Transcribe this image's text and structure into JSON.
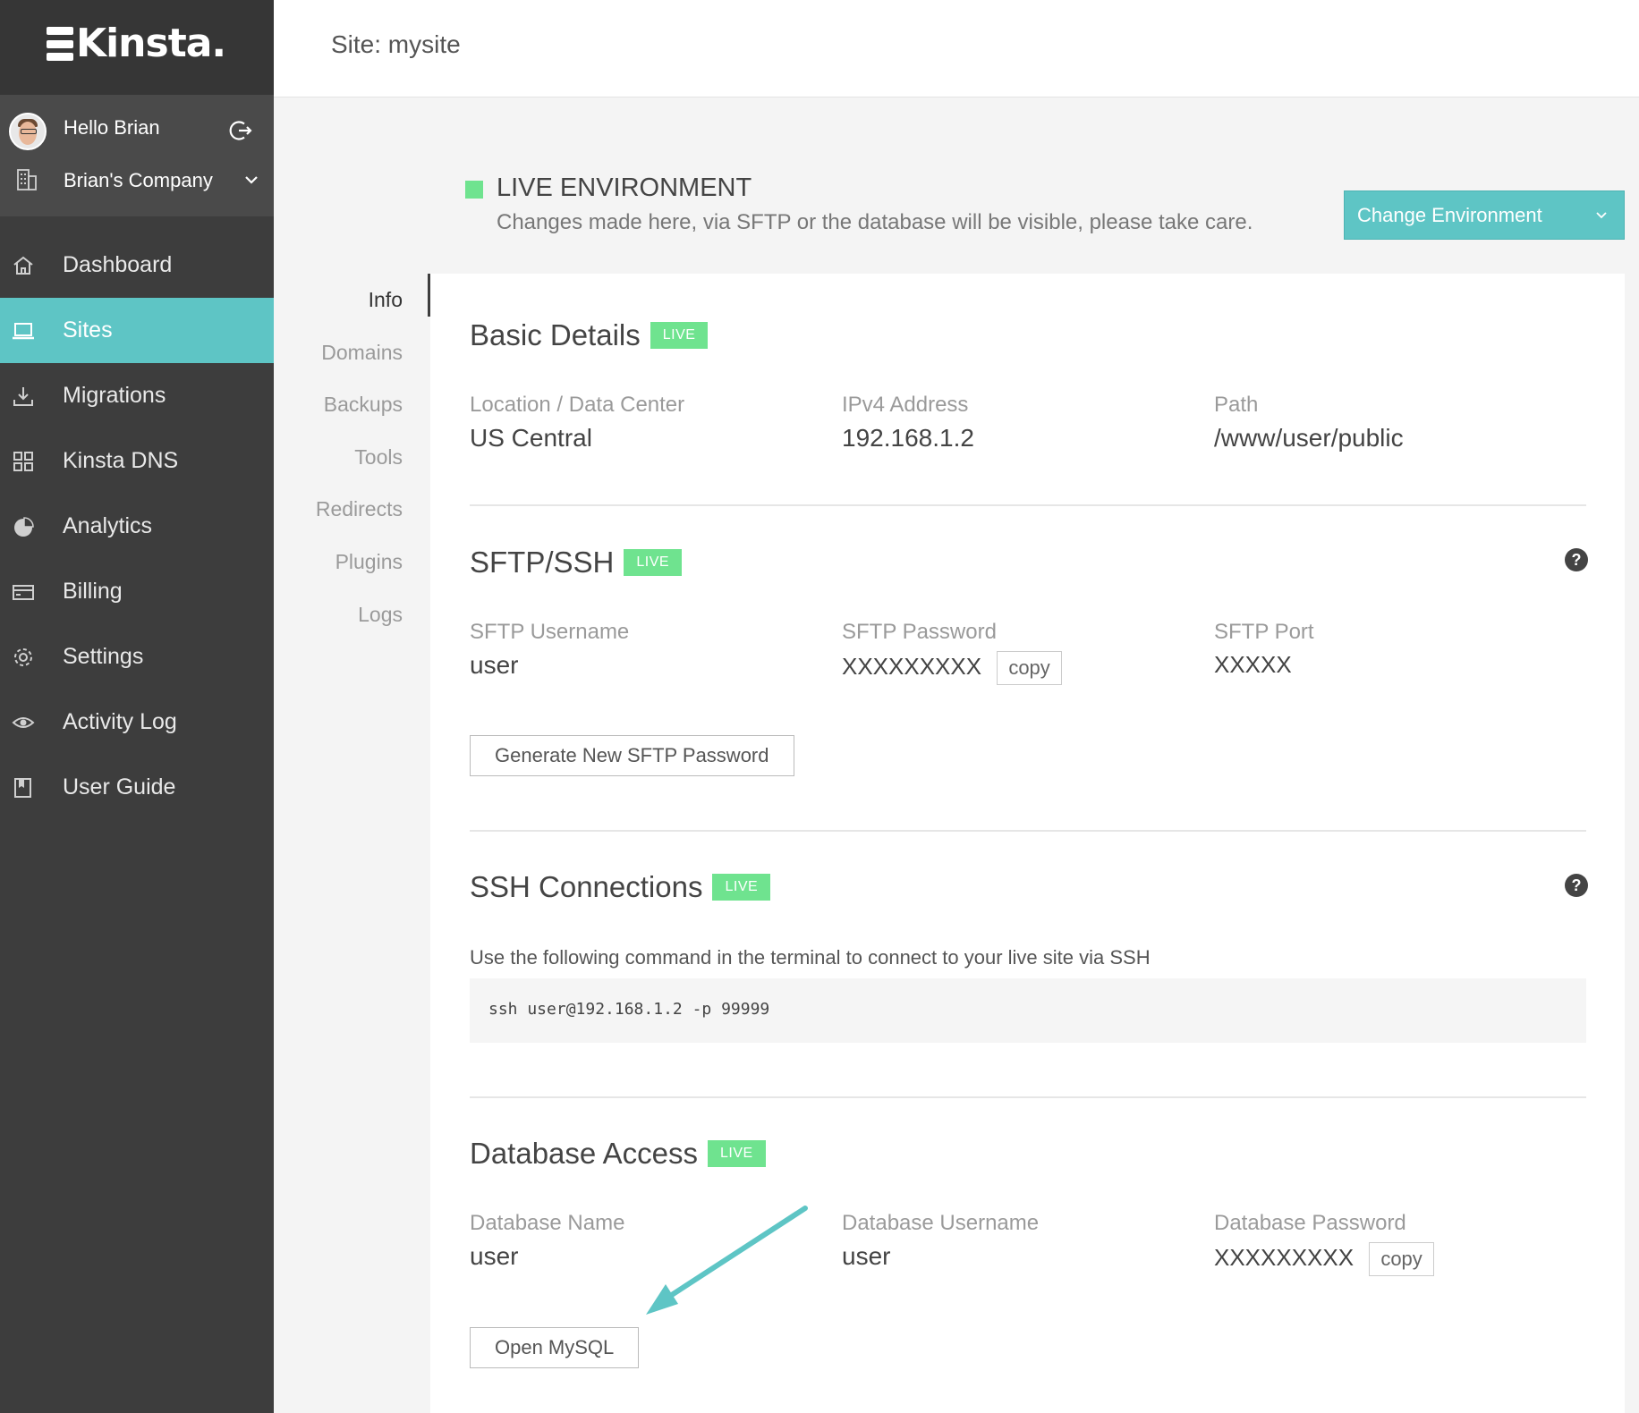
{
  "brand": {
    "logo_text": "Kinsta."
  },
  "user": {
    "greeting": "Hello Brian",
    "company": "Brian's Company"
  },
  "nav": {
    "items": [
      {
        "label": "Dashboard",
        "icon": "home-icon"
      },
      {
        "label": "Sites",
        "icon": "laptop-icon",
        "active": true
      },
      {
        "label": "Migrations",
        "icon": "download-icon"
      },
      {
        "label": "Kinsta DNS",
        "icon": "grid-icon"
      },
      {
        "label": "Analytics",
        "icon": "pie-chart-icon"
      },
      {
        "label": "Billing",
        "icon": "credit-card-icon"
      },
      {
        "label": "Settings",
        "icon": "gear-icon"
      },
      {
        "label": "Activity Log",
        "icon": "eye-icon"
      },
      {
        "label": "User Guide",
        "icon": "book-icon"
      }
    ]
  },
  "header": {
    "title": "Site: mysite"
  },
  "environment": {
    "title": "LIVE ENVIRONMENT",
    "note": "Changes made here, via SFTP or the database will be visible, please take care.",
    "change_button": "Change Environment"
  },
  "tabs": [
    "Info",
    "Domains",
    "Backups",
    "Tools",
    "Redirects",
    "Plugins",
    "Logs"
  ],
  "colors": {
    "accent": "#5ec5c5",
    "live_badge": "#6fe38f",
    "sidebar": "#3d3d3d"
  },
  "basic_details": {
    "title": "Basic Details",
    "badge": "LIVE",
    "location_label": "Location / Data Center",
    "location_value": "US Central",
    "ipv4_label": "IPv4 Address",
    "ipv4_value": "192.168.1.2",
    "path_label": "Path",
    "path_value": "/www/user/public"
  },
  "sftp": {
    "title": "SFTP/SSH",
    "badge": "LIVE",
    "username_label": "SFTP Username",
    "username_value": "user",
    "password_label": "SFTP Password",
    "password_value": "XXXXXXXXX",
    "copy_label": "copy",
    "port_label": "SFTP Port",
    "port_value": "XXXXX",
    "generate_button": "Generate New SFTP Password",
    "help": "?"
  },
  "ssh": {
    "title": "SSH Connections",
    "badge": "LIVE",
    "description": "Use the following command in the terminal to connect to your live site via SSH",
    "command": "ssh user@192.168.1.2 -p 99999",
    "help": "?"
  },
  "database": {
    "title": "Database Access",
    "badge": "LIVE",
    "name_label": "Database Name",
    "name_value": "user",
    "username_label": "Database Username",
    "username_value": "user",
    "password_label": "Database Password",
    "password_value": "XXXXXXXXX",
    "copy_label": "copy",
    "open_button": "Open MySQL"
  }
}
